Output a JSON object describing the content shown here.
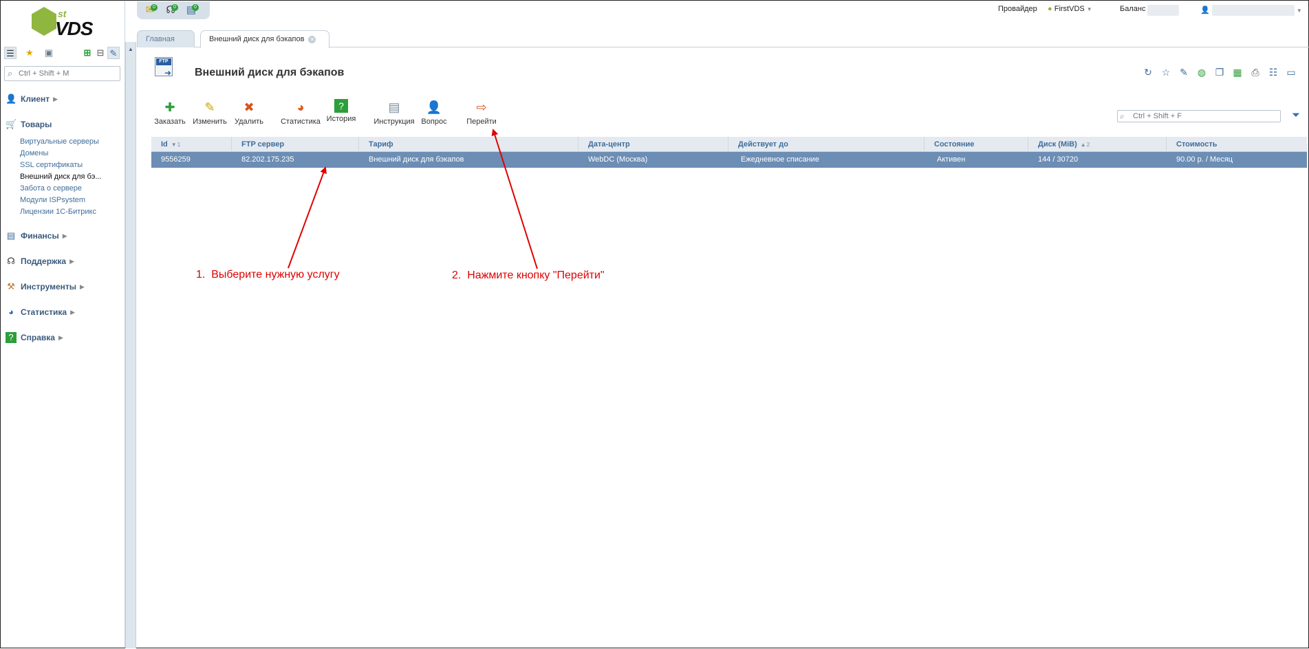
{
  "logo": {
    "sup": "st",
    "name": "VDS"
  },
  "sidebar": {
    "search_placeholder": "Ctrl + Shift + M",
    "groups": [
      {
        "label": "Клиент"
      },
      {
        "label": "Товары"
      },
      {
        "label": "Финансы"
      },
      {
        "label": "Поддержка"
      },
      {
        "label": "Инструменты"
      },
      {
        "label": "Статистика"
      },
      {
        "label": "Справка"
      }
    ],
    "products": [
      "Виртуальные серверы",
      "Домены",
      "SSL сертификаты",
      "Внешний диск для бэ...",
      "Забота о сервере",
      "Модули ISPsystem",
      "Лицензии 1С-Битрикс"
    ]
  },
  "quick": {
    "badges": [
      "0",
      "0",
      "0"
    ]
  },
  "header": {
    "provider_label": "Провайдер",
    "provider_value": "FirstVDS",
    "balance_label": "Баланс"
  },
  "tabs": {
    "home": "Главная",
    "current": "Внешний диск для бэкапов"
  },
  "page": {
    "title": "Внешний диск для бэкапов",
    "ftp_label": "FTP"
  },
  "toolbar": {
    "order": "Заказать",
    "edit": "Изменить",
    "delete": "Удалить",
    "stats": "Статистика",
    "history": "История",
    "instruction": "Инструкция",
    "question": "Вопрос",
    "goto": "Перейти"
  },
  "filter": {
    "placeholder": "Ctrl + Shift + F"
  },
  "table": {
    "columns": [
      "Id",
      "FTP сервер",
      "Тариф",
      "Дата-центр",
      "Действует до",
      "Состояние",
      "Диск (MiB)",
      "Стоимость"
    ],
    "sort_id": "1",
    "sort_disk": "2",
    "row": [
      "9556259",
      "82.202.175.235",
      "Внешний диск для бэкапов",
      "WebDC (Москва)",
      "Ежедневное списание",
      "Активен",
      "144 / 30720",
      "90.00 р. / Месяц"
    ]
  },
  "annotations": {
    "step1_num": "1.",
    "step1_text": "Выберите нужную услугу",
    "step2_num": "2.",
    "step2_text": "Нажмите кнопку \"Перейти\""
  },
  "colors": {
    "selected_row": "#6c8db4",
    "annotation": "#e00000",
    "link": "#3f6d9a",
    "brand_green": "#8fb63f"
  }
}
